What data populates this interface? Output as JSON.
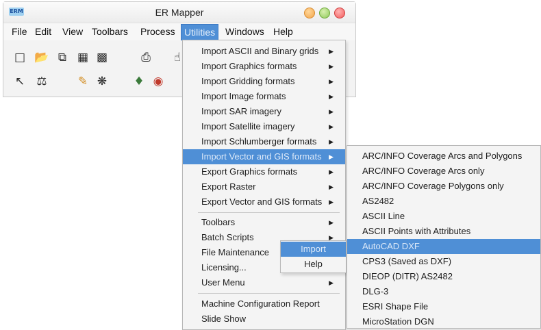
{
  "window": {
    "title": "ER Mapper",
    "logo_text": "ERM"
  },
  "menubar": {
    "items": [
      "File",
      "Edit",
      "View",
      "Toolbars",
      "Process",
      "Utilities",
      "Windows",
      "Help"
    ],
    "active": "Utilities"
  },
  "toolbar": {
    "row1_icons": [
      "new-file-icon",
      "open-folder-icon",
      "copy-icon",
      "save-icon",
      "save-as-icon",
      "print-icon",
      "pointer-icon"
    ],
    "row2_icons": [
      "zoom-tool-icon",
      "balance-icon",
      "paint-icon",
      "fingerprint-icon",
      "layers-icon",
      "target-icon"
    ]
  },
  "utilities_menu": {
    "items": [
      {
        "label": "Import ASCII and Binary grids",
        "submenu": true
      },
      {
        "label": "Import Graphics formats",
        "submenu": true
      },
      {
        "label": "Import Gridding formats",
        "submenu": true
      },
      {
        "label": "Import Image formats",
        "submenu": true
      },
      {
        "label": "Import SAR imagery",
        "submenu": true
      },
      {
        "label": "Import Satellite imagery",
        "submenu": true
      },
      {
        "label": "Import Schlumberger formats",
        "submenu": true
      },
      {
        "label": "Import Vector and GIS formats",
        "submenu": true,
        "highlighted": true
      },
      {
        "label": "Export Graphics formats",
        "submenu": true
      },
      {
        "label": "Export Raster",
        "submenu": true
      },
      {
        "label": "Export Vector and GIS formats",
        "submenu": true
      },
      {
        "label": "Toolbars",
        "submenu": true
      },
      {
        "label": "Batch Scripts",
        "submenu": true
      },
      {
        "label": "File Maintenance",
        "submenu": false
      },
      {
        "label": "Licensing...",
        "submenu": false
      },
      {
        "label": "User Menu",
        "submenu": true
      },
      {
        "label": "Machine Configuration Report",
        "submenu": false
      },
      {
        "label": "Slide Show",
        "submenu": false
      }
    ]
  },
  "vector_gis_submenu": {
    "items": [
      {
        "label": "ARC/INFO Coverage Arcs and Polygons"
      },
      {
        "label": "ARC/INFO Coverage Arcs only"
      },
      {
        "label": "ARC/INFO Coverage Polygons only"
      },
      {
        "label": "AS2482"
      },
      {
        "label": "ASCII Line"
      },
      {
        "label": "ASCII Points with Attributes"
      },
      {
        "label": "AutoCAD DXF",
        "highlighted": true
      },
      {
        "label": "CPS3 (Saved as DXF)"
      },
      {
        "label": "DIEOP (DITR) AS2482"
      },
      {
        "label": "DLG-3"
      },
      {
        "label": "ESRI Shape File"
      },
      {
        "label": "MicroStation DGN"
      }
    ]
  },
  "import_help_submenu": {
    "items": [
      {
        "label": "Import",
        "highlighted": true
      },
      {
        "label": "Help"
      }
    ]
  },
  "colors": {
    "highlight": "#4f8fd6",
    "menu_bg": "#f4f4f4"
  }
}
